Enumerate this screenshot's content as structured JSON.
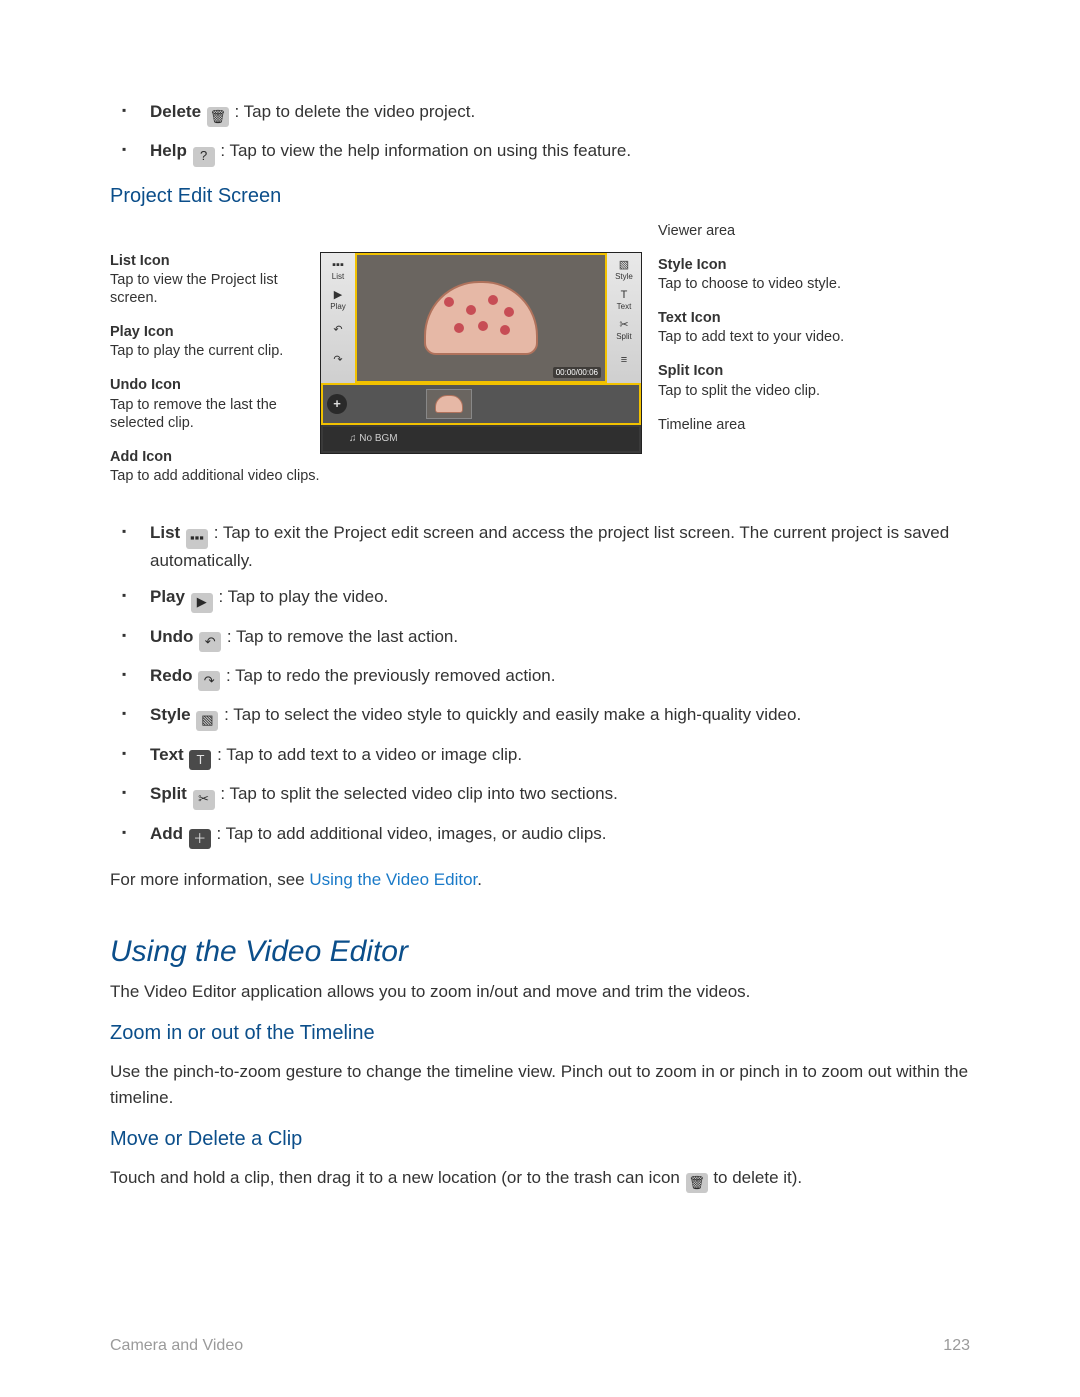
{
  "top_list": [
    {
      "name": "Delete",
      "icon": "trash-icon",
      "text": ": Tap to delete the video project."
    },
    {
      "name": "Help",
      "icon": "help-icon",
      "text": ": Tap to view the help information on using this feature."
    }
  ],
  "h_project_edit": "Project Edit Screen",
  "callouts_left": [
    {
      "title": "List Icon",
      "desc": "Tap to view the Project list screen."
    },
    {
      "title": "Play Icon",
      "desc": "Tap to play the current clip."
    },
    {
      "title": "Undo Icon",
      "desc": "Tap to remove the last the selected clip."
    },
    {
      "title": "Add Icon",
      "desc": "Tap to add additional video clips."
    }
  ],
  "callouts_right": [
    {
      "title": "Viewer area",
      "desc": ""
    },
    {
      "title": "Style Icon",
      "desc": "Tap to choose to video style."
    },
    {
      "title": "Text Icon",
      "desc": "Tap to add text to your video."
    },
    {
      "title": "Split Icon",
      "desc": "Tap to split the video clip."
    },
    {
      "title": "Timeline area",
      "desc": ""
    }
  ],
  "device": {
    "left_btns": [
      {
        "g": "▪▪▪",
        "t": "List"
      },
      {
        "g": "▶",
        "t": "Play"
      },
      {
        "g": "↶",
        "t": ""
      },
      {
        "g": "↷",
        "t": ""
      }
    ],
    "right_btns": [
      {
        "g": "▧",
        "t": "Style"
      },
      {
        "g": "T",
        "t": "Text"
      },
      {
        "g": "✂",
        "t": "Split"
      },
      {
        "g": "≡",
        "t": ""
      }
    ],
    "time": "00:00/00:06",
    "bgm": "♫ No BGM"
  },
  "mid_list": [
    {
      "name": "List",
      "icon": "list-icon",
      "text": ": Tap to exit the Project edit screen and access the project list screen. The current project is saved automatically."
    },
    {
      "name": "Play",
      "icon": "play-icon",
      "text": ": Tap to play the video."
    },
    {
      "name": "Undo",
      "icon": "undo-icon",
      "text": ": Tap to remove the last action."
    },
    {
      "name": "Redo",
      "icon": "redo-icon",
      "text": ": Tap to redo the previously removed action."
    },
    {
      "name": "Style",
      "icon": "style-icon",
      "text": ": Tap to select the video style to quickly and easily make a high-quality video."
    },
    {
      "name": "Text",
      "icon": "text-icon",
      "text": ": Tap to add text to a video or image clip."
    },
    {
      "name": "Split",
      "icon": "split-icon",
      "text": ": Tap to split the selected video clip into two sections."
    },
    {
      "name": "Add",
      "icon": "add-icon",
      "text": ": Tap to add additional video, images, or audio clips."
    }
  ],
  "more_info_prefix": "For more information, see ",
  "more_info_link": "Using the Video Editor",
  "more_info_suffix": ".",
  "h_using": "Using the Video Editor",
  "using_intro": "The Video Editor application allows you to zoom in/out and move and trim the videos.",
  "h_zoom": "Zoom in or out of the Timeline",
  "zoom_text": "Use the pinch-to-zoom gesture to change the timeline view. Pinch out to zoom in or pinch in to zoom out within the timeline.",
  "h_move": "Move or Delete a Clip",
  "move_prefix": "Touch and hold a clip, then drag it to a new location (or to the trash can icon ",
  "move_suffix": " to delete it).",
  "footer_left": "Camera and Video",
  "footer_right": "123",
  "icon_glyphs": {
    "trash-icon": "🗑",
    "help-icon": "?",
    "list-icon": "▪▪▪",
    "play-icon": "▶",
    "undo-icon": "↶",
    "redo-icon": "↷",
    "style-icon": "▧",
    "text-icon": "T",
    "split-icon": "✂",
    "add-icon": "＋"
  }
}
